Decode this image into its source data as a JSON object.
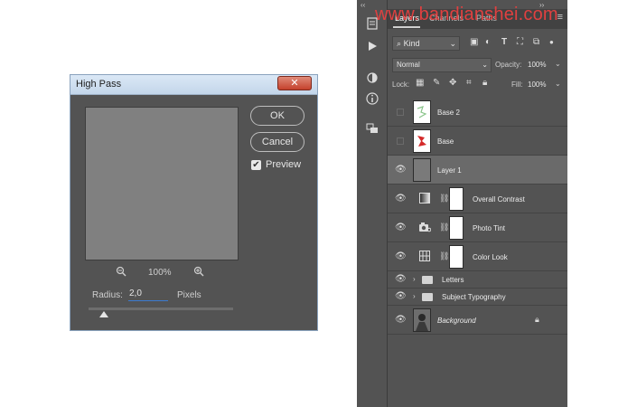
{
  "dialog": {
    "title": "High Pass",
    "close_label": "✕",
    "ok_label": "OK",
    "cancel_label": "Cancel",
    "preview_label": "Preview",
    "preview_checked": true,
    "zoom_level": "100%",
    "radius_label": "Radius:",
    "radius_value": "2,0",
    "radius_units": "Pixels"
  },
  "panel": {
    "tabs": [
      "Layers",
      "Channels",
      "Paths"
    ],
    "active_tab": "Layers",
    "filter_kind": "Kind",
    "blend_mode": "Normal",
    "opacity_label": "Opacity:",
    "opacity_value": "100%",
    "lock_label": "Lock:",
    "fill_label": "Fill:",
    "fill_value": "100%",
    "layers": [
      {
        "name": "Base 2",
        "visible": false,
        "type": "pixel"
      },
      {
        "name": "Base",
        "visible": false,
        "type": "pixel"
      },
      {
        "name": "Layer 1",
        "visible": true,
        "type": "pixel",
        "selected": true
      },
      {
        "name": "Overall Contrast",
        "visible": true,
        "type": "adjustment",
        "icon": "gradient-map-icon"
      },
      {
        "name": "Photo Tint",
        "visible": true,
        "type": "adjustment",
        "icon": "photo-filter-icon"
      },
      {
        "name": "Color Look",
        "visible": true,
        "type": "adjustment",
        "icon": "color-lookup-icon"
      },
      {
        "name": "Letters",
        "visible": true,
        "type": "group"
      },
      {
        "name": "Subject Typography",
        "visible": true,
        "type": "group"
      },
      {
        "name": "Background",
        "visible": true,
        "type": "background",
        "locked": true
      }
    ]
  },
  "watermark": "www.bandianshei.com",
  "colors": {
    "panel_bg": "#535353",
    "selected_row": "#6a6a6a",
    "watermark": "#e04040",
    "dialog_title_bg": "#c3d6ea"
  }
}
